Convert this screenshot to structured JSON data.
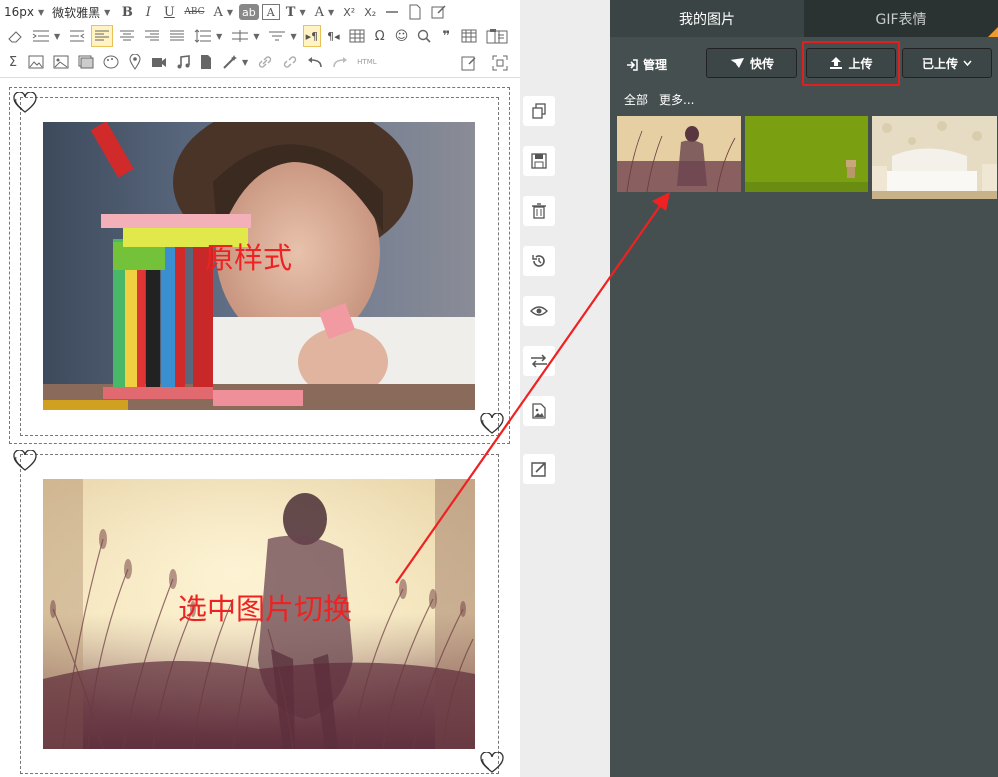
{
  "toolbar": {
    "font_size": "16px",
    "font_family": "微软雅黑",
    "bold": "B",
    "italic": "I",
    "underline": "U",
    "strikethrough": "ABC",
    "font_color": "A",
    "highlight": "ab",
    "border_text": "A",
    "text_style": "T",
    "font_effect": "A",
    "superscript": "X²",
    "subscript": "X₂",
    "omega": "Ω",
    "html": "HTML"
  },
  "canvas": {
    "block1_caption": "原样式",
    "block2_caption": "选中图片切换"
  },
  "panel": {
    "tabs": [
      "我的图片",
      "GIF表情"
    ],
    "manage_label": "管理",
    "quick_upload_label": "快传",
    "upload_label": "上传",
    "uploaded_label": "已上传",
    "filter_all": "全部",
    "filter_more": "更多..."
  },
  "colors": {
    "panel_bg": "#454f4f",
    "tab_active": "#3b4444",
    "tab_inactive": "#2b3232",
    "highlight_red": "#e02020",
    "toolbar_active": "#fff3c4",
    "annotation_red": "#ee2222"
  }
}
